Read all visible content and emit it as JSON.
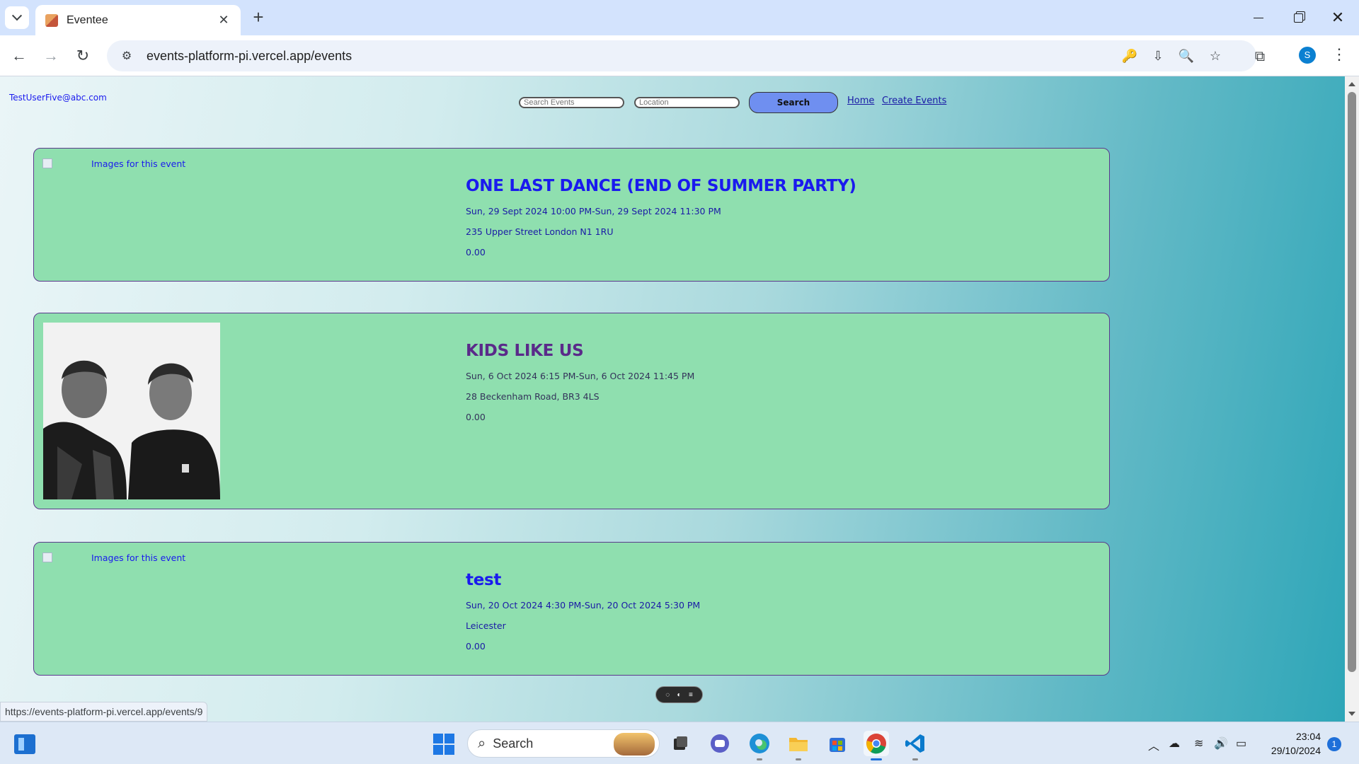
{
  "browser": {
    "tab_title": "Eventee",
    "tab_close": "✕",
    "new_tab": "+",
    "url": "events-platform-pi.vercel.app/events",
    "status_url": "https://events-platform-pi.vercel.app/events/9",
    "profile_initial": "S"
  },
  "header": {
    "user_email": "TestUserFive@abc.com",
    "search_placeholder": "Search Events",
    "location_placeholder": "Location",
    "search_button": "Search",
    "home_link": "Home",
    "create_link": "Create Events"
  },
  "events": [
    {
      "title": "ONE LAST DANCE (END OF SUMMER PARTY)",
      "image_alt": "Images for this event",
      "datetime": "Sun, 29 Sept 2024 10:00 PM-Sun, 29 Sept 2024 11:30 PM",
      "address": "235 Upper Street London N1 1RU",
      "price": "0.00"
    },
    {
      "title": "KIDS LIKE US",
      "image_alt": "",
      "datetime": "Sun, 6 Oct 2024 6:15 PM-Sun, 6 Oct 2024 11:45 PM",
      "address": "28 Beckenham Road, BR3 4LS",
      "price": "0.00"
    },
    {
      "title": "test",
      "image_alt": "Images for this event",
      "datetime": "Sun, 20 Oct 2024 4:30 PM-Sun, 20 Oct 2024 5:30 PM",
      "address": "Leicester",
      "price": "0.00"
    }
  ],
  "taskbar": {
    "search_label": "Search",
    "time": "23:04",
    "date": "29/10/2024",
    "notification_count": "1"
  }
}
